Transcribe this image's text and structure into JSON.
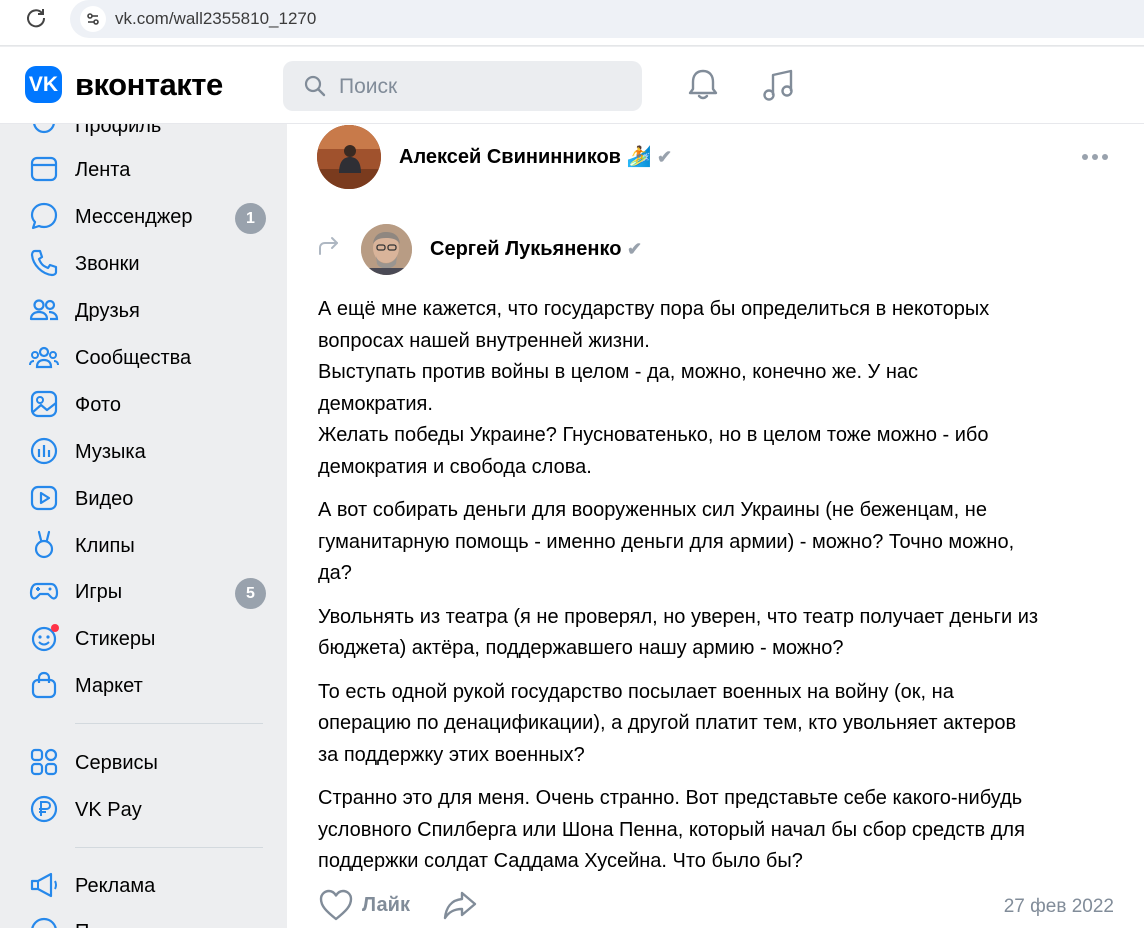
{
  "browser": {
    "url": "vk.com/wall2355810_1270"
  },
  "header": {
    "logo_text": "вконтакте",
    "logo_letter": "VK",
    "search_placeholder": "Поиск"
  },
  "sidebar": {
    "items": [
      {
        "label": "Профиль",
        "icon": "profile-icon"
      },
      {
        "label": "Лента",
        "icon": "feed-icon"
      },
      {
        "label": "Мессенджер",
        "icon": "messenger-icon",
        "badge": "1"
      },
      {
        "label": "Звонки",
        "icon": "phone-icon"
      },
      {
        "label": "Друзья",
        "icon": "friends-icon"
      },
      {
        "label": "Сообщества",
        "icon": "communities-icon"
      },
      {
        "label": "Фото",
        "icon": "photo-icon"
      },
      {
        "label": "Музыка",
        "icon": "music-icon"
      },
      {
        "label": "Видео",
        "icon": "video-icon"
      },
      {
        "label": "Клипы",
        "icon": "clips-icon"
      },
      {
        "label": "Игры",
        "icon": "games-icon",
        "badge": "5"
      },
      {
        "label": "Стикеры",
        "icon": "stickers-icon"
      },
      {
        "label": "Маркет",
        "icon": "market-icon"
      },
      {
        "label": "Сервисы",
        "icon": "services-icon"
      },
      {
        "label": "VK Pay",
        "icon": "vkpay-icon"
      },
      {
        "label": "Реклама",
        "icon": "ads-icon"
      },
      {
        "label": "П",
        "icon": "help-icon"
      }
    ]
  },
  "post": {
    "author": "Алексей Свининников",
    "repost_author": "Сергей Лукьяненко",
    "paragraphs": [
      "А ещё мне кажется, что государству пора бы определиться в некоторых\nвопросах нашей внутренней жизни.\nВыступать против войны в целом - да, можно, конечно же. У нас\nдемократия.\nЖелать победы Украине? Гнусноватенько, но в целом тоже можно - ибо\nдемократия и свобода слова.",
      "А вот собирать деньги для вооруженных сил Украины (не беженцам, не\nгуманитарную помощь - именно деньги для армии) - можно? Точно можно,\nда?",
      "Увольнять из театра (я не проверял, но уверен, что театр получает деньги из\nбюджета) актёра, поддержавшего нашу армию - можно?",
      "То есть одной рукой государство посылает военных на войну (ок, на\nоперацию по денацификации), а другой платит тем, кто увольняет актеров\nза поддержку этих военных?",
      "Странно это для меня. Очень странно. Вот представьте себе какого-нибудь\nусловного Спилберга или Шона Пенна, который начал бы сбор средств для\nподдержки солдат Саддама Хусейна. Что было бы?"
    ],
    "like_label": "Лайк",
    "date": "27 фев 2022"
  }
}
